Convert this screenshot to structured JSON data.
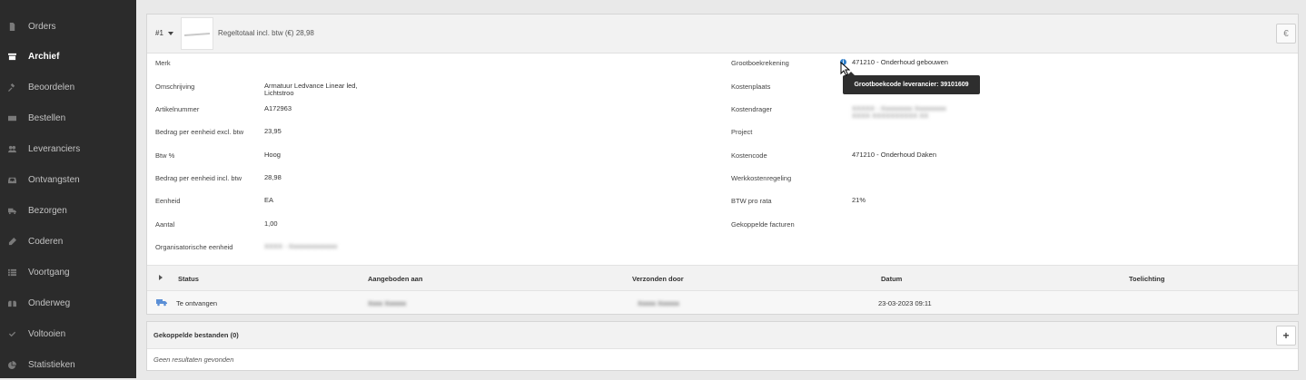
{
  "sidebar": {
    "items": [
      {
        "label": "Orders",
        "icon": "file-icon",
        "active": false
      },
      {
        "label": "Archief",
        "icon": "archive-icon",
        "active": true
      },
      {
        "label": "Beoordelen",
        "icon": "gavel-icon",
        "active": false
      },
      {
        "label": "Bestellen",
        "icon": "envelope-icon",
        "active": false
      },
      {
        "label": "Leveranciers",
        "icon": "users-icon",
        "active": false
      },
      {
        "label": "Ontvangsten",
        "icon": "inbox-icon",
        "active": false
      },
      {
        "label": "Bezorgen",
        "icon": "truck-icon",
        "active": false
      },
      {
        "label": "Coderen",
        "icon": "pencil-icon",
        "active": false
      },
      {
        "label": "Voortgang",
        "icon": "list-icon",
        "active": false
      },
      {
        "label": "Onderweg",
        "icon": "binoculars-icon",
        "active": false
      },
      {
        "label": "Voltooien",
        "icon": "check-icon",
        "active": false
      },
      {
        "label": "Statistieken",
        "icon": "pie-chart-icon",
        "active": false
      }
    ]
  },
  "line": {
    "number": "#1",
    "total_label": "Regeltotaal incl. btw (€) 28,98",
    "currency_button": "€"
  },
  "details_left": [
    {
      "label": "Merk",
      "value": ""
    },
    {
      "label": "Omschrijving",
      "value": "Armatuur Ledvance Linear led, Lichtstroo"
    },
    {
      "label": "Artikelnummer",
      "value": "A172963"
    },
    {
      "label": "Bedrag per eenheid excl. btw",
      "value": "23,95"
    },
    {
      "label": "Btw %",
      "value": "Hoog"
    },
    {
      "label": "Bedrag per eenheid incl. btw",
      "value": "28,98"
    },
    {
      "label": "Eenheid",
      "value": "EA"
    },
    {
      "label": "Aantal",
      "value": "1,00"
    },
    {
      "label": "Organisatorische eenheid",
      "value": "XXXX - Xxxxxxxxxxxxxx"
    }
  ],
  "details_right": [
    {
      "label": "Grootboekrekening",
      "value": "471210 - Onderhoud gebouwen"
    },
    {
      "label": "Kostenplaats",
      "value": ""
    },
    {
      "label": "Kostendrager",
      "value": "XXXXX - Xxxxxxxxx Xxxxxxxxx XXXX XXXXXXXXXX XX"
    },
    {
      "label": "Project",
      "value": ""
    },
    {
      "label": "Kostencode",
      "value": "471210 - Onderhoud Daken"
    },
    {
      "label": "Werkkostenregeling",
      "value": ""
    },
    {
      "label": "BTW pro rata",
      "value": "21%"
    },
    {
      "label": "Gekoppelde facturen",
      "value": ""
    }
  ],
  "tooltip": {
    "text": "Grootboekcode leverancier: 39101609",
    "info_glyph": "i"
  },
  "status_table": {
    "headers": {
      "status": "Status",
      "offered_to": "Aangeboden aan",
      "sent_by": "Verzonden door",
      "date": "Datum",
      "note": "Toelichting"
    },
    "rows": [
      {
        "status": "Te ontvangen",
        "offered_to": "Xxxx Xxxxxx",
        "sent_by": "Xxxxx Xxxxxx",
        "date": "23-03-2023 09:11",
        "note": ""
      }
    ]
  },
  "files": {
    "title": "Gekoppelde bestanden (0)",
    "empty_text": "Geen resultaten gevonden",
    "add_button": "+"
  }
}
